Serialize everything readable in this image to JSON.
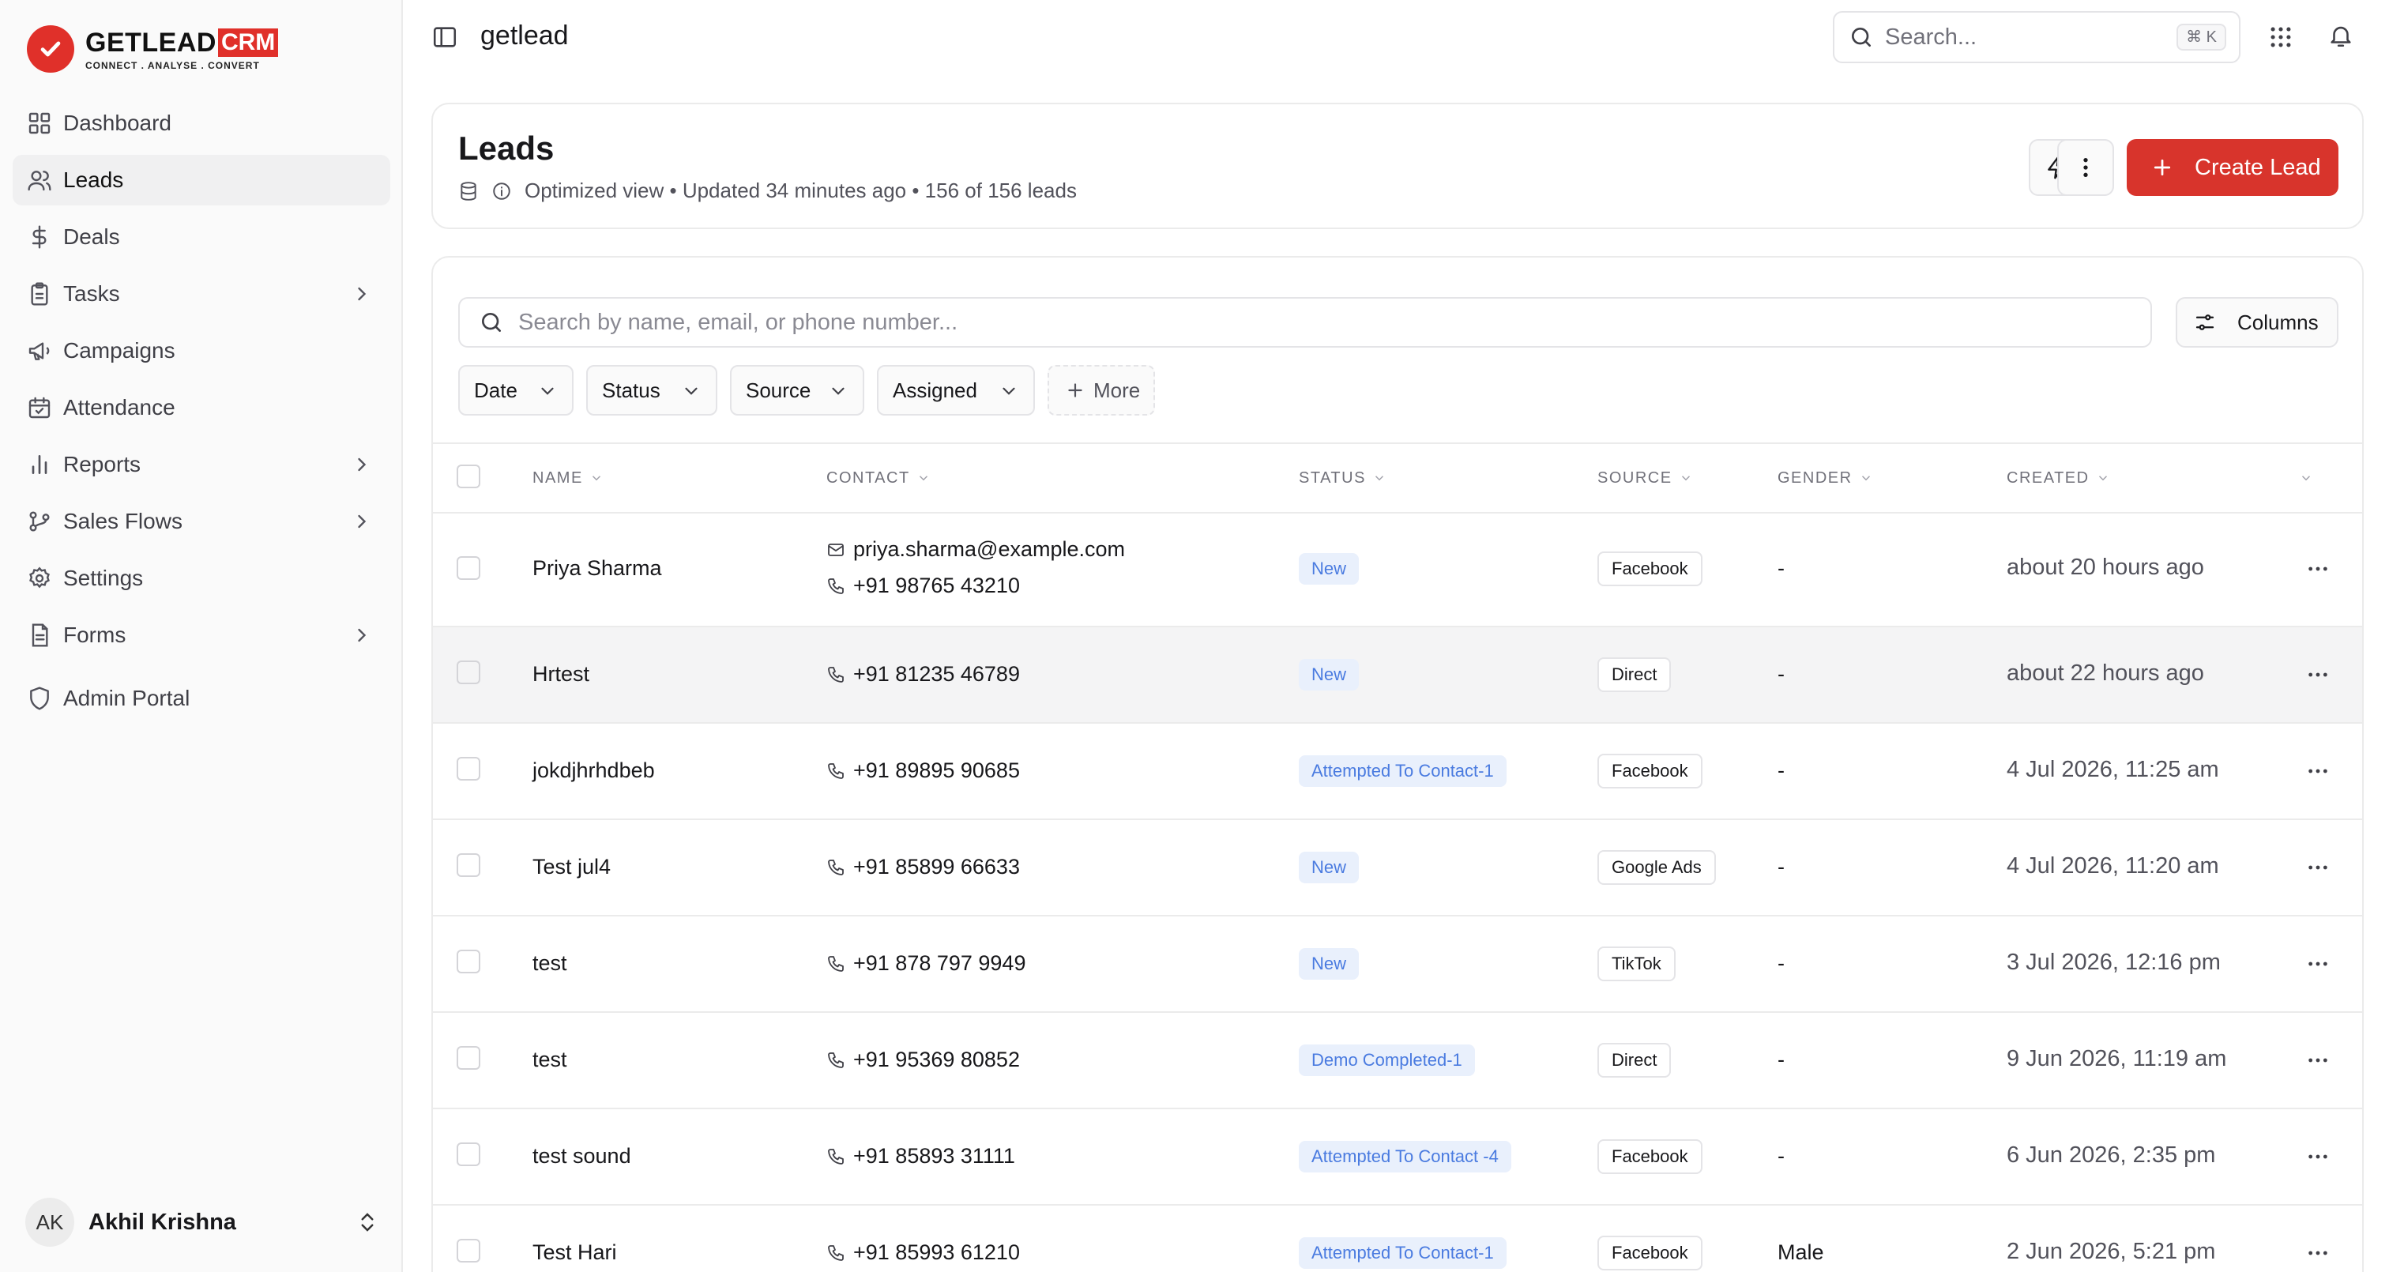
{
  "brand": {
    "name": "GETLEAD",
    "crm": "CRM",
    "tagline": "CONNECT . ANALYSE . CONVERT"
  },
  "sidebar": {
    "items": [
      {
        "label": "Dashboard",
        "icon": "dashboard-icon",
        "active": false
      },
      {
        "label": "Leads",
        "icon": "users-icon",
        "active": true
      },
      {
        "label": "Deals",
        "icon": "dollar-icon",
        "active": false
      },
      {
        "label": "Tasks",
        "icon": "clipboard-icon",
        "active": false,
        "expandable": true
      },
      {
        "label": "Campaigns",
        "icon": "megaphone-icon",
        "active": false
      },
      {
        "label": "Attendance",
        "icon": "calendar-check-icon",
        "active": false
      },
      {
        "label": "Reports",
        "icon": "bar-chart-icon",
        "active": false,
        "expandable": true
      },
      {
        "label": "Sales Flows",
        "icon": "git-branch-icon",
        "active": false,
        "expandable": true
      },
      {
        "label": "Settings",
        "icon": "gear-icon",
        "active": false
      },
      {
        "label": "Forms",
        "icon": "form-icon",
        "active": false,
        "expandable": true
      },
      {
        "label": "Admin Portal",
        "icon": "shield-icon",
        "active": false
      }
    ],
    "user": {
      "initials": "AK",
      "name": "Akhil Krishna"
    }
  },
  "topbar": {
    "workspace": "getlead",
    "search_placeholder": "Search...",
    "shortcut": "⌘ K"
  },
  "header": {
    "title": "Leads",
    "meta": "Optimized view • Updated 34 minutes ago • 156 of 156 leads",
    "create_label": "Create Lead"
  },
  "table": {
    "search_placeholder": "Search by name, email, or phone number...",
    "columns_label": "Columns",
    "filters": [
      "Date",
      "Status",
      "Source",
      "Assigned"
    ],
    "more_label": "More",
    "headers": [
      "NAME",
      "CONTACT",
      "STATUS",
      "SOURCE",
      "GENDER",
      "CREATED"
    ],
    "rows": [
      {
        "name": "Priya Sharma",
        "email": "priya.sharma@example.com",
        "phone": "+91 98765 43210",
        "status": "New",
        "source": "Facebook",
        "gender": "-",
        "created": "about 20 hours ago"
      },
      {
        "name": "Hrtest",
        "email": "",
        "phone": "+91 81235 46789",
        "status": "New",
        "source": "Direct",
        "gender": "-",
        "created": "about 22 hours ago"
      },
      {
        "name": "jokdjhrhdbeb",
        "email": "",
        "phone": "+91 89895 90685",
        "status": "Attempted To Contact-1",
        "source": "Facebook",
        "gender": "-",
        "created": "4 Jul 2026, 11:25 am"
      },
      {
        "name": "Test jul4",
        "email": "",
        "phone": "+91 85899 66633",
        "status": "New",
        "source": "Google Ads",
        "gender": "-",
        "created": "4 Jul 2026, 11:20 am"
      },
      {
        "name": "test",
        "email": "",
        "phone": "+91 878 797 9949",
        "status": "New",
        "source": "TikTok",
        "gender": "-",
        "created": "3 Jul 2026, 12:16 pm"
      },
      {
        "name": "test",
        "email": "",
        "phone": "+91 95369 80852",
        "status": "Demo Completed-1",
        "source": "Direct",
        "gender": "-",
        "created": "9 Jun 2026, 11:19 am"
      },
      {
        "name": "test sound",
        "email": "",
        "phone": "+91 85893 31111",
        "status": "Attempted To Contact -4",
        "source": "Facebook",
        "gender": "-",
        "created": "6 Jun 2026, 2:35 pm"
      },
      {
        "name": "Test Hari",
        "email": "",
        "phone": "+91 85993 61210",
        "status": "Attempted To Contact-1",
        "source": "Facebook",
        "gender": "Male",
        "created": "2 Jun 2026, 5:21 pm"
      }
    ]
  },
  "colors": {
    "brand": "#e0302a",
    "create_button": "#d8342c",
    "status_text": "#4a7be0",
    "status_bg": "#e9f0fc"
  }
}
